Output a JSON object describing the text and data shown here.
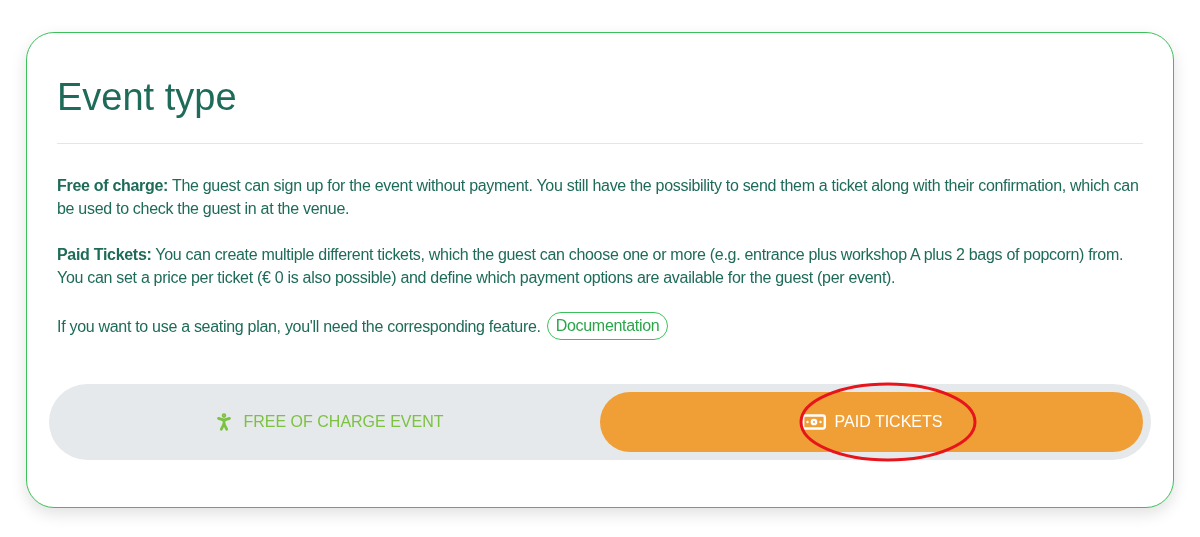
{
  "title": "Event type",
  "paragraphs": [
    "**Free of charge:** The guest can sign up for the event without payment. You still have the possibility to send them a ticket along with their confirmation, which can be used to check the guest in at the venue.",
    "**Paid Tickets:** You can create multiple different tickets, which the guest can choose one or more (e.g. entrance plus workshop A plus 2 bags of popcorn) from. You can set a price per ticket (€ 0 is also possible) and define which payment options are available for the guest (per event)."
  ],
  "seating_note": {
    "text": "If you want to use a seating plan, you'll need the corresponding feature.",
    "link": "Documentation"
  },
  "options": [
    {
      "kind": "person",
      "label": "FREE OF CHARGE EVENT",
      "selected": false
    },
    {
      "kind": "banknote",
      "label": "PAID TICKETS",
      "selected": true
    }
  ]
}
